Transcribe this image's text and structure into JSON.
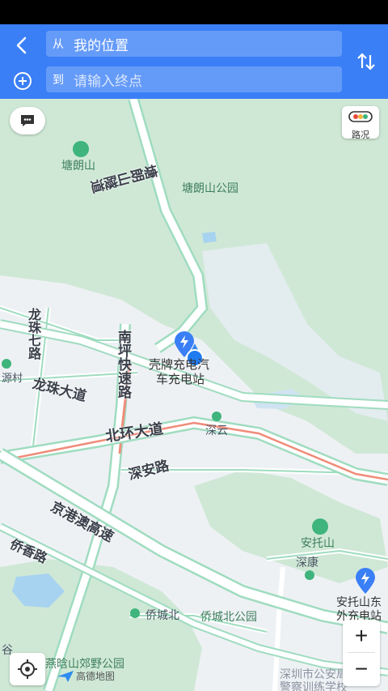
{
  "header": {
    "from_prefix": "从",
    "from_value": "我的位置",
    "to_prefix": "到",
    "to_placeholder": "请输入终点"
  },
  "map": {
    "traffic_label": "路况",
    "places": {
      "tanglangshan": "塘朗山",
      "tanglangshan_park": "塘朗山公园",
      "charging_station_line1": "壳牌充电汽",
      "charging_station_line2": "车充电站",
      "yuancun": "源村",
      "shenyun": "深云",
      "antuoshan": "安托山",
      "shenkang": "深康",
      "antuoshan_station_line1": "安托山东",
      "antuoshan_station_line2": "外充电站",
      "qiaochengbei": "侨城北",
      "qiaochengbei_park": "侨城北公园",
      "yanhanshan_park": "燕晗山郊野公园",
      "police_school_line1": "深圳市公安局",
      "police_school_line2": "警察训练学校",
      "gu": "谷"
    },
    "roads": {
      "tanglangshan_tunnel": "塘朗山隧道",
      "longzhu_7": "龙珠七路",
      "longzhu_avenue": "龙珠大道",
      "nanping_expressway": "南坪快速路",
      "beihuan_avenue": "北环大道",
      "shenan_road": "深安路",
      "jinggangao_expressway": "京港澳高速",
      "qiaoxiang_road": "侨香路"
    },
    "brand": "高德地图"
  },
  "colors": {
    "header": "#3a7ff6",
    "green_area": "#cfe8d6",
    "road": "#ffffff",
    "road_border": "#9fdcc0",
    "traffic_jam": "#f08c7a",
    "location": "#1f7bf0"
  }
}
